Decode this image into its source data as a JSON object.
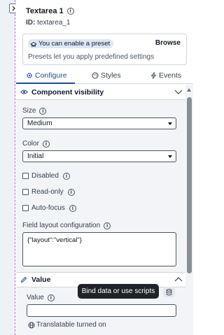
{
  "sidebar": {
    "collapse_icon": "panel-collapse-icon"
  },
  "header": {
    "title": "Textarea 1",
    "id_label": "ID:",
    "id_value": "textarea_1"
  },
  "preset": {
    "badge": "You can enable a preset",
    "browse": "Browse",
    "description": "Presets let you apply predefined settings"
  },
  "tabs": [
    {
      "label": "Configure",
      "icon": "gear-icon",
      "active": true
    },
    {
      "label": "Styles",
      "icon": "palette-icon",
      "active": false
    },
    {
      "label": "Events",
      "icon": "lightning-icon",
      "active": false
    }
  ],
  "visibility": {
    "title": "Component visibility"
  },
  "size": {
    "label": "Size",
    "value": "Medium"
  },
  "color": {
    "label": "Color",
    "value": "Initial"
  },
  "checkboxes": [
    {
      "label": "Disabled",
      "checked": false
    },
    {
      "label": "Read-only",
      "checked": false
    },
    {
      "label": "Auto-focus",
      "checked": false
    }
  ],
  "field_layout": {
    "label": "Field layout configuration",
    "value": "{\"layout\":\"vertical\"}"
  },
  "value_section": {
    "title": "Value",
    "field_label": "Value",
    "value": "",
    "tooltip": "Bind data or use scripts",
    "translatable": "Translatable turned on"
  },
  "colors": {
    "accent": "#1d4f91",
    "tooltip_bg": "#1f2328",
    "panel_bg": "#f2f4f7",
    "dashed_border": "#c06bc9"
  }
}
